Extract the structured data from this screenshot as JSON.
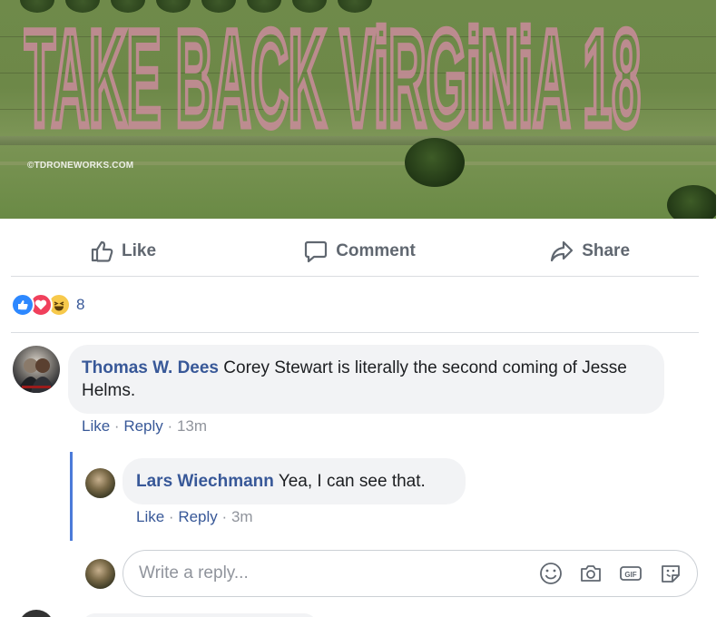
{
  "photo": {
    "crop_text": "TAKE BACK ViRGiNiA 18",
    "watermark": "©TDRONEWORKS.COM"
  },
  "actions": {
    "like_label": "Like",
    "comment_label": "Comment",
    "share_label": "Share"
  },
  "reactions": {
    "types": [
      "like",
      "love",
      "haha"
    ],
    "count": "8"
  },
  "comments": [
    {
      "author": "Thomas W. Dees",
      "text": "Corey Stewart is literally the second coming of Jesse Helms.",
      "like_label": "Like",
      "separator": "·",
      "reply_label": "Reply",
      "time": "13m",
      "replies": [
        {
          "author": "Lars Wiechmann",
          "text": "Yea, I can see that.",
          "like_label": "Like",
          "separator": "·",
          "reply_label": "Reply",
          "time": "3m"
        }
      ]
    }
  ],
  "reply_input": {
    "placeholder": "Write a reply...",
    "tools": [
      "emoji-icon",
      "camera-icon",
      "gif-icon",
      "sticker-icon"
    ]
  },
  "colors": {
    "link_blue": "#385898",
    "muted_gray": "#90949c",
    "bubble_bg": "#f2f3f5",
    "thread_line": "#4b7bd9",
    "like_blue": "#2d88ff",
    "love_red": "#f0405c",
    "haha_yellow": "#f7c94b"
  }
}
